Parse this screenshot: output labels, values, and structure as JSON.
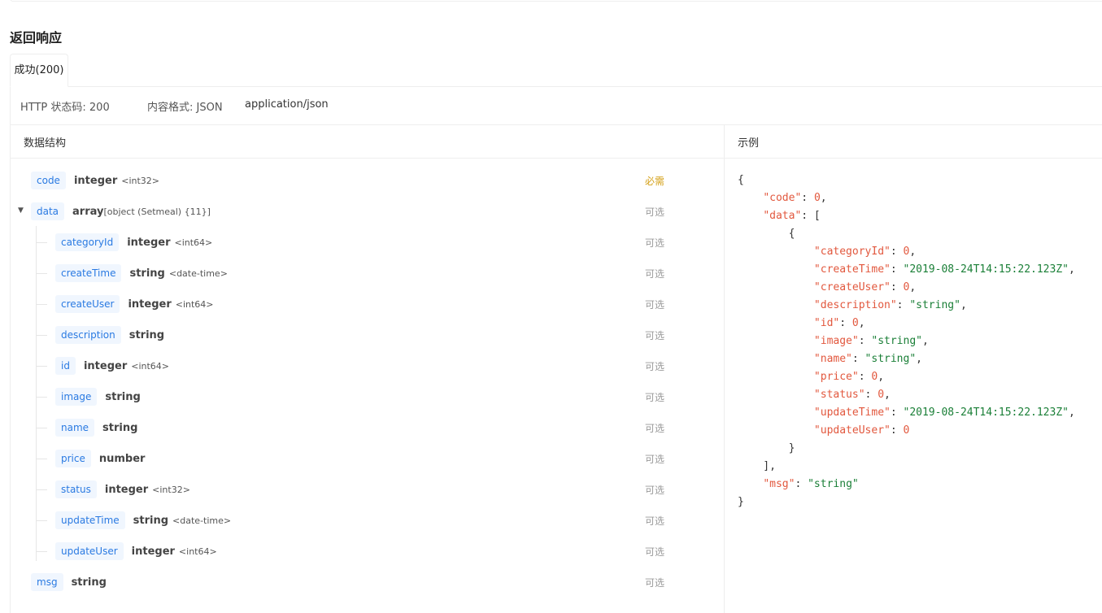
{
  "section_title": "返回响应",
  "tab_label": "成功(200)",
  "meta": {
    "status_code": "HTTP 状态码: 200",
    "content_format": "内容格式: JSON",
    "content_type": "application/json"
  },
  "columns": {
    "schema": "数据结构",
    "example": "示例"
  },
  "fields": [
    {
      "name": "code",
      "type": "integer",
      "format": "<int32>",
      "required": "必需"
    },
    {
      "name": "data",
      "type": "array",
      "format": "[object (Setmeal) {11}]",
      "required": "可选"
    },
    {
      "name": "categoryId",
      "type": "integer",
      "format": "<int64>",
      "required": "可选"
    },
    {
      "name": "createTime",
      "type": "string",
      "format": "<date-time>",
      "required": "可选"
    },
    {
      "name": "createUser",
      "type": "integer",
      "format": "<int64>",
      "required": "可选"
    },
    {
      "name": "description",
      "type": "string",
      "format": "",
      "required": "可选"
    },
    {
      "name": "id",
      "type": "integer",
      "format": "<int64>",
      "required": "可选"
    },
    {
      "name": "image",
      "type": "string",
      "format": "",
      "required": "可选"
    },
    {
      "name": "name",
      "type": "string",
      "format": "",
      "required": "可选"
    },
    {
      "name": "price",
      "type": "number",
      "format": "",
      "required": "可选"
    },
    {
      "name": "status",
      "type": "integer",
      "format": "<int32>",
      "required": "可选"
    },
    {
      "name": "updateTime",
      "type": "string",
      "format": "<date-time>",
      "required": "可选"
    },
    {
      "name": "updateUser",
      "type": "integer",
      "format": "<int64>",
      "required": "可选"
    },
    {
      "name": "msg",
      "type": "string",
      "format": "",
      "required": "可选"
    }
  ],
  "example": {
    "code": "0",
    "categoryId": "0",
    "createTime": "\"2019-08-24T14:15:22.123Z\"",
    "createUser": "0",
    "description": "\"string\"",
    "id": "0",
    "image": "\"string\"",
    "name": "\"string\"",
    "price": "0",
    "status": "0",
    "updateTime": "\"2019-08-24T14:15:22.123Z\"",
    "updateUser": "0",
    "msg": "\"string\""
  }
}
